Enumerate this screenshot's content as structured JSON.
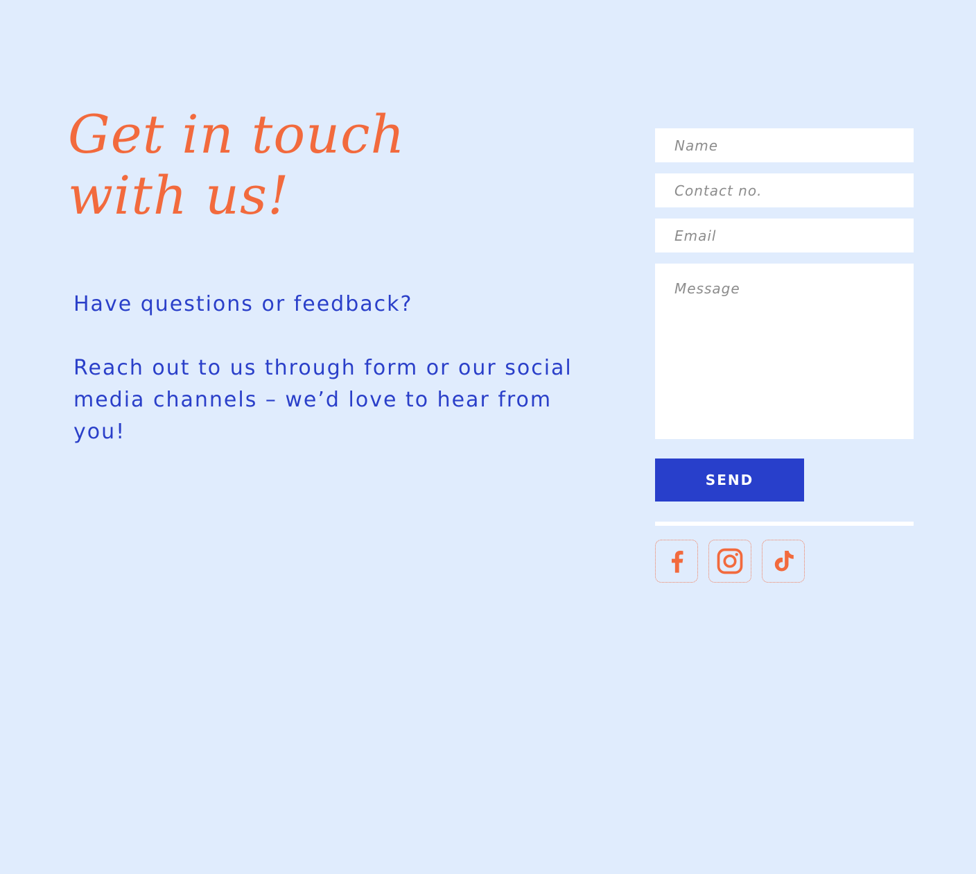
{
  "heading": {
    "line1": "Get in touch",
    "line2": "with us!"
  },
  "intro": {
    "question": "Have questions or feedback?",
    "body": "Reach out to us through form or our social media channels – we’d  love to hear from you!"
  },
  "form": {
    "name_placeholder": "Name",
    "contact_placeholder": "Contact no.",
    "email_placeholder": "Email",
    "message_placeholder": "Message",
    "send_label": "SEND"
  },
  "socials": [
    {
      "icon": "facebook-icon"
    },
    {
      "icon": "instagram-icon"
    },
    {
      "icon": "tiktok-icon"
    }
  ],
  "colors": {
    "background": "#e0ecfd",
    "accent": "#f26a3d",
    "primary": "#283fcb",
    "text": "#2a3fc9"
  }
}
